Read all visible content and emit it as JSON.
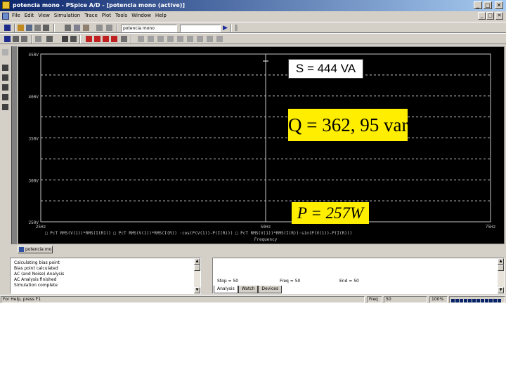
{
  "window": {
    "title": "potencia mono - PSpice A/D - [potencia mono (active)]",
    "controls": [
      "_",
      "□",
      "✕"
    ]
  },
  "menu": {
    "items": [
      "File",
      "Edit",
      "View",
      "Simulation",
      "Trace",
      "Plot",
      "Tools",
      "Window",
      "Help"
    ],
    "mdi_controls": [
      "_",
      "□",
      "✕"
    ]
  },
  "toolbar": {
    "profile_combo": "potencia mono",
    "combo_blank": ""
  },
  "plot": {
    "background": "#000000",
    "grid_color": "#c8c8c8",
    "y_ticks": [
      "450V",
      "400V",
      "350V",
      "300V",
      "250V"
    ],
    "x_ticks": [
      "25Hz",
      "50Hz",
      "75Hz"
    ],
    "xlabel": "Frequency",
    "trace_legend": "□ PcT RMS(V(1))*RMS(I(R1))   □ PcT RMS(V(1))*RMS(I(R)) ·cos(P(V(1))-P(I(R)))   □ PcT RMS(V(1))*RMS(I(R))·sin(P(V(1))-P(I(R)))"
  },
  "chart_data": {
    "type": "line",
    "title": "",
    "xlabel": "Frequency",
    "ylabel": "",
    "x_ticks": [
      "25Hz",
      "50Hz",
      "75Hz"
    ],
    "y_ticks": [
      "250V",
      "300V",
      "350V",
      "400V",
      "450V"
    ],
    "xlim": [
      25,
      75
    ],
    "ylim": [
      250,
      450
    ],
    "grid": true,
    "series": []
  },
  "annotations": {
    "s": "S = 444 VA",
    "q": "Q = 362, 95 var",
    "p": "P = 257W"
  },
  "minimized_doc": {
    "label": "potencia mo..."
  },
  "output": {
    "lines": [
      "Calculating bias point",
      "Bias point calculated",
      "AC (and Noise) Analysis",
      "AC Analysis finished",
      "Simulation complete"
    ]
  },
  "sim_status": {
    "fields": [
      "Stop = 50",
      "Freq = 50",
      "End = 50"
    ],
    "tabs": [
      "Analysis",
      "Watch",
      "Devices"
    ],
    "active_tab": "Analysis"
  },
  "statusbar": {
    "help": "For Help, press F1",
    "freq_label": "Freq",
    "freq_value": "50",
    "percent": "100%",
    "progress": 1.0
  },
  "colors": {
    "chrome": "#d4d0c8",
    "titlebar_start": "#0a246a",
    "titlebar_end": "#a6caf0",
    "highlight_yellow": "#ffee00"
  }
}
